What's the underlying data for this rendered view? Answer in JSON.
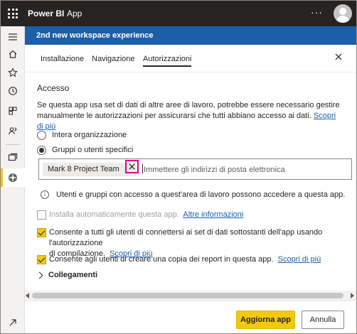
{
  "topbar": {
    "brand": "Power BI",
    "section": "App",
    "more": "···"
  },
  "workspace": {
    "title": "2nd new workspace experience"
  },
  "tabs": [
    {
      "label": "Installazione"
    },
    {
      "label": "Navigazione"
    },
    {
      "label": "Autorizzazioni"
    }
  ],
  "access": {
    "heading": "Accesso",
    "description": "Se questa app usa set di dati di altre aree di lavoro, potrebbe essere necessario gestire manualmente le autorizzazioni per assicurarsi che tutti abbiano accesso ai dati.",
    "learn_more": "Scopri di più",
    "radio_all": "Intera organizzazione",
    "radio_specific": "Gruppi o utenti specifici",
    "selected_option": "Gruppi o utenti specifici",
    "chip_label": "Mark 8 Project Team",
    "input_placeholder": "Immettere gli indirizzi di posta elettronica",
    "info_text": "Utenti e gruppi con accesso a quest'area di lavoro possono accedere a questa app."
  },
  "options": {
    "auto_install": {
      "label": "Installa automaticamente questa app.",
      "link": "Altre informazioni",
      "checked": false
    },
    "build_permission": {
      "label_line1": "Consente a tutti gli utenti di connettersi ai set di dati sottostanti dell'app usando l'autorizzazione",
      "label_line2": "di compilazione.",
      "link": "Scopri di più",
      "checked": true
    },
    "copy_permission": {
      "label": "Consente agli utenti di creare una copia dei report in questa app.",
      "link": "Scopri di più",
      "checked": true
    }
  },
  "links_section": {
    "label": "Collegamenti"
  },
  "footer": {
    "primary_label": "Aggiorna app",
    "secondary_label": "Annulla"
  },
  "colors": {
    "topbar": "#252423",
    "workspace_header": "#1b5fa8",
    "accent_yellow": "#f2c811",
    "highlight_pink": "#e3008c",
    "link": "#1b5fa8"
  },
  "icons": {
    "left_nav": [
      "hamburger-icon",
      "home-icon",
      "star-icon",
      "clock-icon",
      "apps-icon",
      "shared-icon",
      "workspaces-icon",
      "app-icon",
      "expand-icon"
    ]
  }
}
